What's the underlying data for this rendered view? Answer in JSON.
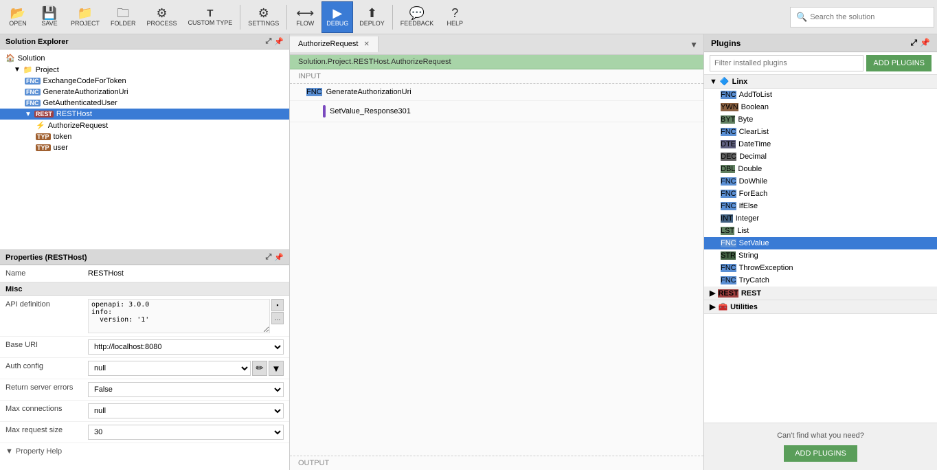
{
  "toolbar": {
    "buttons": [
      {
        "id": "open",
        "icon": "📂",
        "label": "OPEN"
      },
      {
        "id": "save",
        "icon": "💾",
        "label": "SAVE"
      },
      {
        "id": "project",
        "icon": "📁",
        "label": "PROJECT"
      },
      {
        "id": "folder",
        "icon": "🗀",
        "label": "FOLDER"
      },
      {
        "id": "process",
        "icon": "⚙",
        "label": "PROCESS"
      },
      {
        "id": "custom-type",
        "icon": "T",
        "label": "CUSTOM TYPE"
      },
      {
        "id": "settings",
        "icon": "⚙",
        "label": "SETTINGS"
      },
      {
        "id": "flow",
        "icon": "⟷",
        "label": "FLOW"
      },
      {
        "id": "debug",
        "icon": "▶",
        "label": "DEBUG"
      },
      {
        "id": "deploy",
        "icon": "⬆",
        "label": "DEPLOY"
      },
      {
        "id": "feedback",
        "icon": "💬",
        "label": "FEEDBACK"
      },
      {
        "id": "help",
        "icon": "?",
        "label": "HELP"
      }
    ],
    "search_placeholder": "Search the solution"
  },
  "solution_explorer": {
    "title": "Solution Explorer",
    "tree": [
      {
        "indent": 0,
        "icon": "🏠",
        "badge": "",
        "label": "Solution",
        "toggle": false
      },
      {
        "indent": 1,
        "icon": "📁",
        "badge": "",
        "label": "Project",
        "toggle": true,
        "expanded": true
      },
      {
        "indent": 2,
        "badge_type": "fnc",
        "badge": "FNC",
        "label": "ExchangeCodeForToken"
      },
      {
        "indent": 2,
        "badge_type": "fnc",
        "badge": "FNC",
        "label": "GenerateAuthorizationUri"
      },
      {
        "indent": 2,
        "badge_type": "fnc",
        "badge": "FNC",
        "label": "GetAuthenticatedUser"
      },
      {
        "indent": 2,
        "icon": "🔗",
        "badge": "REST",
        "badge_type": "rest",
        "label": "RESTHost",
        "selected": true,
        "toggle": true,
        "expanded": true
      },
      {
        "indent": 3,
        "icon": "⚡",
        "badge": "",
        "label": "AuthorizeRequest"
      },
      {
        "indent": 3,
        "badge_type": "typ",
        "badge": "TYP",
        "label": "token"
      },
      {
        "indent": 3,
        "badge_type": "typ",
        "badge": "TYP",
        "label": "user"
      }
    ]
  },
  "properties": {
    "title": "Properties (RESTHost)",
    "name_label": "Name",
    "name_value": "RESTHost",
    "misc_label": "Misc",
    "api_definition_label": "API definition",
    "api_definition_value": "openapi: 3.0.0\ninfo:\n  version: '1'",
    "base_uri_label": "Base URI",
    "base_uri_value": "http://localhost:8080",
    "auth_config_label": "Auth config",
    "auth_config_value": "null",
    "return_errors_label": "Return server errors",
    "return_errors_value": "False",
    "max_connections_label": "Max connections",
    "max_connections_value": "null",
    "max_request_label": "Max request size",
    "max_request_value": "30",
    "property_help_label": "Property Help"
  },
  "editor": {
    "tab_label": "AuthorizeRequest",
    "breadcrumb": "Solution.Project.RESTHost.AuthorizeRequest",
    "input_label": "INPUT",
    "output_label": "OUTPUT",
    "flow_items": [
      {
        "badge": "FNC",
        "badge_type": "fnc",
        "label": "GenerateAuthorizationUri",
        "indented": false
      },
      {
        "icon": "⬛",
        "color": "purple",
        "label": "SetValue_Response301",
        "indented": true
      }
    ]
  },
  "plugins": {
    "title": "Plugins",
    "filter_placeholder": "Filter installed plugins",
    "add_plugins_label": "ADD PLUGINS",
    "sections": [
      {
        "id": "linx",
        "icon": "🔷",
        "badge": "",
        "label": "Linx",
        "expanded": true,
        "items": [
          {
            "badge": "FNC",
            "badge_type": "fnc",
            "label": "AddToList"
          },
          {
            "badge": "YWN",
            "badge_type": "ywn",
            "label": "Boolean"
          },
          {
            "badge": "BYT",
            "badge_type": "byt",
            "label": "Byte"
          },
          {
            "badge": "FNC",
            "badge_type": "fnc",
            "label": "ClearList"
          },
          {
            "badge": "DTE",
            "badge_type": "dte",
            "label": "DateTime"
          },
          {
            "badge": "DEC",
            "badge_type": "dec",
            "label": "Decimal"
          },
          {
            "badge": "DBL",
            "badge_type": "dbl",
            "label": "Double"
          },
          {
            "badge": "FNC",
            "badge_type": "fnc",
            "label": "DoWhile"
          },
          {
            "badge": "FNC",
            "badge_type": "fnc",
            "label": "ForEach"
          },
          {
            "badge": "FNC",
            "badge_type": "fnc",
            "label": "IfElse"
          },
          {
            "badge": "INT",
            "badge_type": "int",
            "label": "Integer"
          },
          {
            "badge": "LST",
            "badge_type": "lst",
            "label": "List"
          },
          {
            "badge": "FNC",
            "badge_type": "fnc",
            "label": "SetValue",
            "selected": true
          },
          {
            "badge": "STR",
            "badge_type": "str",
            "label": "String"
          },
          {
            "badge": "FNC",
            "badge_type": "fnc",
            "label": "ThrowException"
          },
          {
            "badge": "FNC",
            "badge_type": "fnc",
            "label": "TryCatch"
          }
        ]
      },
      {
        "id": "rest",
        "icon": "🔗",
        "badge": "REST",
        "label": "REST",
        "expanded": false,
        "items": []
      },
      {
        "id": "utilities",
        "icon": "🧰",
        "badge": "",
        "label": "Utilities",
        "expanded": false,
        "items": []
      }
    ],
    "footer_text": "Can't find what you need?",
    "footer_btn_label": "ADD PLUGINS"
  }
}
